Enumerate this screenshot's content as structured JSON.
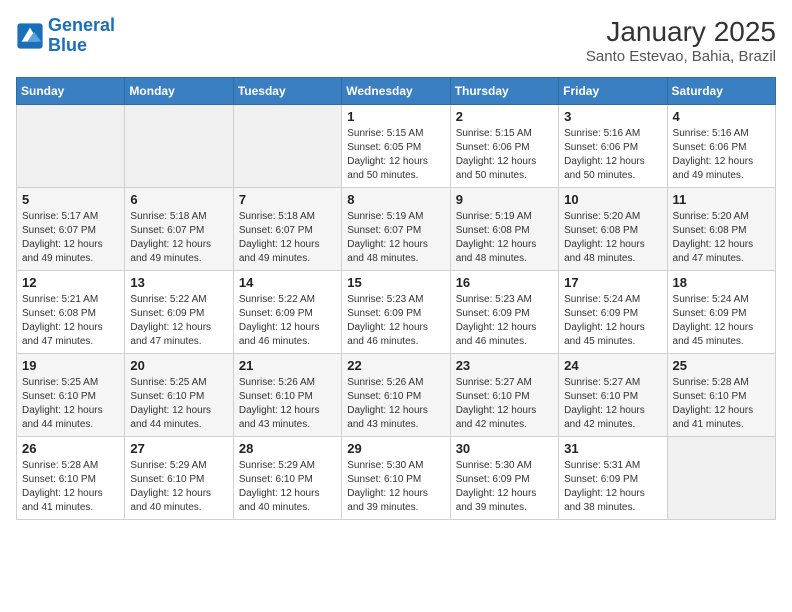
{
  "logo": {
    "general": "General",
    "blue": "Blue"
  },
  "title": "January 2025",
  "subtitle": "Santo Estevao, Bahia, Brazil",
  "days_header": [
    "Sunday",
    "Monday",
    "Tuesday",
    "Wednesday",
    "Thursday",
    "Friday",
    "Saturday"
  ],
  "weeks": [
    [
      {
        "day": "",
        "info": ""
      },
      {
        "day": "",
        "info": ""
      },
      {
        "day": "",
        "info": ""
      },
      {
        "day": "1",
        "info": "Sunrise: 5:15 AM\nSunset: 6:05 PM\nDaylight: 12 hours\nand 50 minutes."
      },
      {
        "day": "2",
        "info": "Sunrise: 5:15 AM\nSunset: 6:06 PM\nDaylight: 12 hours\nand 50 minutes."
      },
      {
        "day": "3",
        "info": "Sunrise: 5:16 AM\nSunset: 6:06 PM\nDaylight: 12 hours\nand 50 minutes."
      },
      {
        "day": "4",
        "info": "Sunrise: 5:16 AM\nSunset: 6:06 PM\nDaylight: 12 hours\nand 49 minutes."
      }
    ],
    [
      {
        "day": "5",
        "info": "Sunrise: 5:17 AM\nSunset: 6:07 PM\nDaylight: 12 hours\nand 49 minutes."
      },
      {
        "day": "6",
        "info": "Sunrise: 5:18 AM\nSunset: 6:07 PM\nDaylight: 12 hours\nand 49 minutes."
      },
      {
        "day": "7",
        "info": "Sunrise: 5:18 AM\nSunset: 6:07 PM\nDaylight: 12 hours\nand 49 minutes."
      },
      {
        "day": "8",
        "info": "Sunrise: 5:19 AM\nSunset: 6:07 PM\nDaylight: 12 hours\nand 48 minutes."
      },
      {
        "day": "9",
        "info": "Sunrise: 5:19 AM\nSunset: 6:08 PM\nDaylight: 12 hours\nand 48 minutes."
      },
      {
        "day": "10",
        "info": "Sunrise: 5:20 AM\nSunset: 6:08 PM\nDaylight: 12 hours\nand 48 minutes."
      },
      {
        "day": "11",
        "info": "Sunrise: 5:20 AM\nSunset: 6:08 PM\nDaylight: 12 hours\nand 47 minutes."
      }
    ],
    [
      {
        "day": "12",
        "info": "Sunrise: 5:21 AM\nSunset: 6:08 PM\nDaylight: 12 hours\nand 47 minutes."
      },
      {
        "day": "13",
        "info": "Sunrise: 5:22 AM\nSunset: 6:09 PM\nDaylight: 12 hours\nand 47 minutes."
      },
      {
        "day": "14",
        "info": "Sunrise: 5:22 AM\nSunset: 6:09 PM\nDaylight: 12 hours\nand 46 minutes."
      },
      {
        "day": "15",
        "info": "Sunrise: 5:23 AM\nSunset: 6:09 PM\nDaylight: 12 hours\nand 46 minutes."
      },
      {
        "day": "16",
        "info": "Sunrise: 5:23 AM\nSunset: 6:09 PM\nDaylight: 12 hours\nand 46 minutes."
      },
      {
        "day": "17",
        "info": "Sunrise: 5:24 AM\nSunset: 6:09 PM\nDaylight: 12 hours\nand 45 minutes."
      },
      {
        "day": "18",
        "info": "Sunrise: 5:24 AM\nSunset: 6:09 PM\nDaylight: 12 hours\nand 45 minutes."
      }
    ],
    [
      {
        "day": "19",
        "info": "Sunrise: 5:25 AM\nSunset: 6:10 PM\nDaylight: 12 hours\nand 44 minutes."
      },
      {
        "day": "20",
        "info": "Sunrise: 5:25 AM\nSunset: 6:10 PM\nDaylight: 12 hours\nand 44 minutes."
      },
      {
        "day": "21",
        "info": "Sunrise: 5:26 AM\nSunset: 6:10 PM\nDaylight: 12 hours\nand 43 minutes."
      },
      {
        "day": "22",
        "info": "Sunrise: 5:26 AM\nSunset: 6:10 PM\nDaylight: 12 hours\nand 43 minutes."
      },
      {
        "day": "23",
        "info": "Sunrise: 5:27 AM\nSunset: 6:10 PM\nDaylight: 12 hours\nand 42 minutes."
      },
      {
        "day": "24",
        "info": "Sunrise: 5:27 AM\nSunset: 6:10 PM\nDaylight: 12 hours\nand 42 minutes."
      },
      {
        "day": "25",
        "info": "Sunrise: 5:28 AM\nSunset: 6:10 PM\nDaylight: 12 hours\nand 41 minutes."
      }
    ],
    [
      {
        "day": "26",
        "info": "Sunrise: 5:28 AM\nSunset: 6:10 PM\nDaylight: 12 hours\nand 41 minutes."
      },
      {
        "day": "27",
        "info": "Sunrise: 5:29 AM\nSunset: 6:10 PM\nDaylight: 12 hours\nand 40 minutes."
      },
      {
        "day": "28",
        "info": "Sunrise: 5:29 AM\nSunset: 6:10 PM\nDaylight: 12 hours\nand 40 minutes."
      },
      {
        "day": "29",
        "info": "Sunrise: 5:30 AM\nSunset: 6:10 PM\nDaylight: 12 hours\nand 39 minutes."
      },
      {
        "day": "30",
        "info": "Sunrise: 5:30 AM\nSunset: 6:09 PM\nDaylight: 12 hours\nand 39 minutes."
      },
      {
        "day": "31",
        "info": "Sunrise: 5:31 AM\nSunset: 6:09 PM\nDaylight: 12 hours\nand 38 minutes."
      },
      {
        "day": "",
        "info": ""
      }
    ]
  ],
  "colors": {
    "header_bg": "#3a7fc1",
    "empty_bg": "#efefef"
  }
}
